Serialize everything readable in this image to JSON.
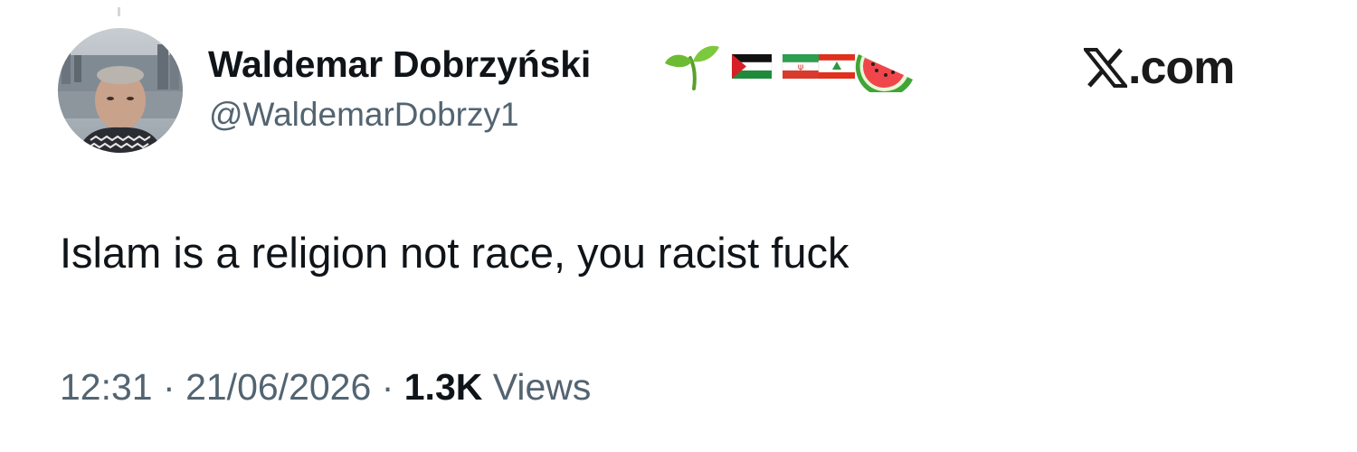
{
  "author": {
    "display_name": "Waldemar Dobrzyński",
    "handle": "@WaldemarDobrzy1",
    "name_emojis": [
      "seedling-icon",
      "palestine-flag-icon",
      "iran-flag-icon",
      "lebanon-flag-icon",
      "watermelon-icon"
    ]
  },
  "platform": {
    "logo_name": "x-logo-icon",
    "label": ".com"
  },
  "tweet": {
    "text": "Islam is a religion not race, you racist fuck"
  },
  "meta": {
    "time": "12:31",
    "separator": "·",
    "date": "21/06/2026",
    "views_count": "1.3K",
    "views_label": "Views"
  },
  "colors": {
    "text_primary": "#0f1419",
    "text_secondary": "#536471",
    "background": "#ffffff"
  }
}
